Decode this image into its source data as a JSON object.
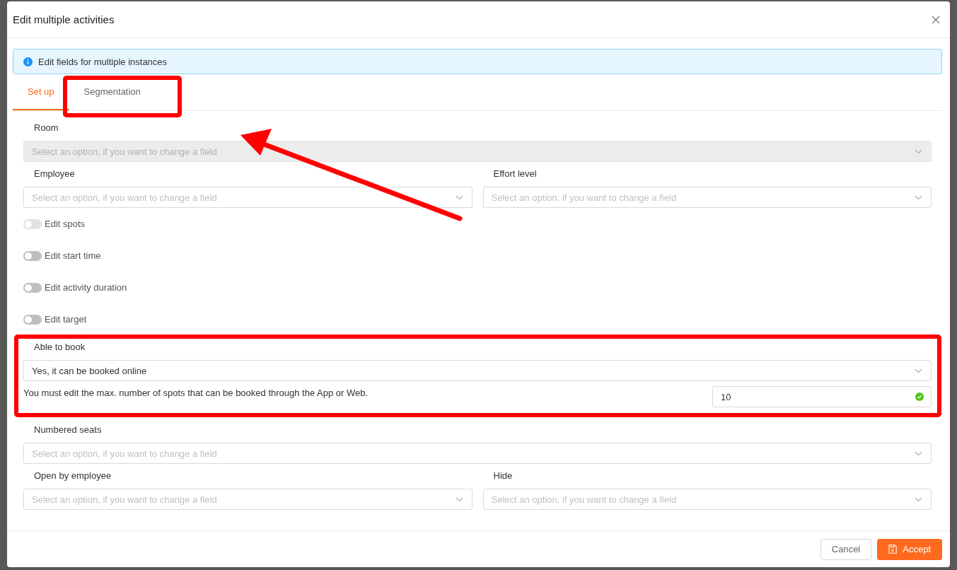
{
  "dialog": {
    "title": "Edit multiple activities"
  },
  "alert": {
    "text": "Edit fields for multiple instances"
  },
  "tabs": [
    {
      "label": "Set up",
      "selected": true
    },
    {
      "label": "Segmentation",
      "selected": false
    }
  ],
  "rows": [
    {
      "kind": "selects",
      "items": [
        {
          "label": "Room",
          "placeholder": "Select an option, if you want to change a field",
          "disabled": true
        }
      ]
    },
    {
      "kind": "selects",
      "items": [
        {
          "label": "Employee",
          "placeholder": "Select an option, if you want to change a field",
          "disabled": false
        },
        {
          "label": "Effort level",
          "placeholder": "Select an option, if you want to change a field",
          "disabled": false
        }
      ]
    },
    {
      "kind": "toggle",
      "label": "Edit spots",
      "on": false,
      "disabled": true
    },
    {
      "kind": "toggle",
      "label": "Edit start time",
      "on": false,
      "disabled": false
    },
    {
      "kind": "toggle",
      "label": "Edit activity duration",
      "on": false,
      "disabled": false
    },
    {
      "kind": "toggle",
      "label": "Edit target",
      "on": false,
      "disabled": false
    },
    {
      "kind": "selects",
      "items": [
        {
          "label": "Able to book",
          "value": "Yes, it can be booked online",
          "disabled": false
        }
      ]
    },
    {
      "kind": "note",
      "text": "You must edit the max. number of spots that can be booked through the App or Web.",
      "value": "10",
      "valid": true
    },
    {
      "kind": "selects",
      "items": [
        {
          "label": "Numbered seats",
          "placeholder": "Select an option, if you want to change a field",
          "disabled": false
        }
      ]
    },
    {
      "kind": "selects",
      "items": [
        {
          "label": "Open by employee",
          "placeholder": "Select an option, if you want to change a field",
          "disabled": false
        },
        {
          "label": "Hide",
          "placeholder": "Select an option, if you want to change a field",
          "disabled": false
        }
      ]
    }
  ],
  "buttons": [
    {
      "label": "Cancel",
      "kind": "secondary"
    },
    {
      "label": "Accept",
      "kind": "primary"
    }
  ]
}
